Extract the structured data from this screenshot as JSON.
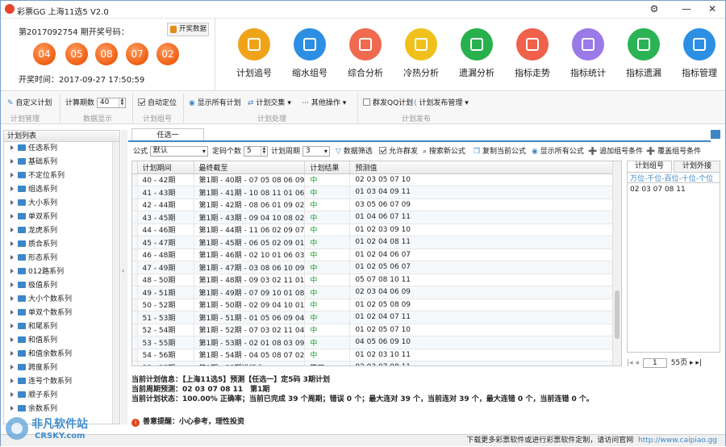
{
  "window": {
    "title": "彩票GG 上海11选5 V2.0",
    "gear": "⚙",
    "minimize": "—",
    "close": "✕"
  },
  "draw": {
    "title": "第2017092754 期开奖号码：",
    "button": "开奖数据",
    "balls": [
      "04",
      "05",
      "08",
      "07",
      "02"
    ],
    "time": "开奖时间：2017-09-27 17:50:59"
  },
  "bigbuttons": [
    {
      "label": "计划追号",
      "color": "#f0a319",
      "icon": "monitor-icon"
    },
    {
      "label": "缩水组号",
      "color": "#2d8fe3",
      "icon": "rocket-icon"
    },
    {
      "label": "综合分析",
      "color": "#f06a4f",
      "icon": "pie-chart-icon"
    },
    {
      "label": "冷热分析",
      "color": "#f0c11c",
      "icon": "sun-icon"
    },
    {
      "label": "遗漏分析",
      "color": "#27b04c",
      "icon": "bar-chart-icon"
    },
    {
      "label": "指标走势",
      "color": "#f0604a",
      "icon": "trend-icon"
    },
    {
      "label": "指标统计",
      "color": "#9a7ae6",
      "icon": "stats-icon"
    },
    {
      "label": "指标遗漏",
      "color": "#2ab354",
      "icon": "share-icon"
    },
    {
      "label": "指标管理",
      "color": "#2d8fe3",
      "icon": "sliders-icon"
    }
  ],
  "toolbar": {
    "custom_plan": "自定义计划",
    "calc_periods_label": "计算期数",
    "calc_periods_value": "40",
    "auto_locate": "自动定位",
    "show_all": "显示所有计划",
    "plan_cross": "计划交集",
    "other_ops": "其他操作",
    "qq_plan": "群发QQ计划",
    "publish": "计划发布管理",
    "group_plan": "计划管理",
    "group_data": "数据显示",
    "group_number": "计划组号",
    "group_process": "计划处理",
    "group_publish": "计划发布"
  },
  "left": {
    "header": "计划列表",
    "items": [
      "任选系列",
      "基础系列",
      "不定位系列",
      "组选系列",
      "大小系列",
      "单双系列",
      "龙虎系列",
      "质合系列",
      "形态系列",
      "012路系列",
      "极值系列",
      "大小个数系列",
      "单双个数系列",
      "和尾系列",
      "和值系列",
      "和值余数系列",
      "跨度系列",
      "连号个数系列",
      "顺子系列",
      "余数系列"
    ]
  },
  "tab": {
    "label": "任选一"
  },
  "formula": {
    "label": "公式",
    "value": "默认",
    "code_count_label": "定码个数",
    "code_count": "5",
    "cycle_label": "计划周期",
    "cycle": "3",
    "filter": "数据筛选",
    "allow_group": "允许群发",
    "search": "搜索新公式",
    "copy": "复制当前公式",
    "show_all": "显示所有公式",
    "add_cond": "追加组号条件",
    "cover_cond": "覆盖组号条件"
  },
  "grid": {
    "columns": [
      "计划期间",
      "最终截至",
      "计划结果",
      "预测值"
    ],
    "rows": [
      [
        "40 - 42期",
        "第1期 - 40期 - 07 05 08 06 09",
        "中",
        "02 03 05 07 10"
      ],
      [
        "41 - 43期",
        "第1期 - 41期 - 10 08 11 01 06",
        "中",
        "01 03 04 09 11"
      ],
      [
        "42 - 44期",
        "第1期 - 42期 - 08 06 01 09 02",
        "中",
        "03 05 06 07 09"
      ],
      [
        "43 - 45期",
        "第1期 - 43期 - 09 04 10 08 02",
        "中",
        "01 04 06 07 11"
      ],
      [
        "44 - 46期",
        "第1期 - 44期 - 11 06 02 09 07",
        "中",
        "01 02 03 09 10"
      ],
      [
        "45 - 47期",
        "第1期 - 45期 - 06 05 02 09 01",
        "中",
        "01 02 04 08 11"
      ],
      [
        "46 - 48期",
        "第1期 - 46期 - 02 10 01 06 03",
        "中",
        "01 02 04 06 07"
      ],
      [
        "47 - 49期",
        "第1期 - 47期 - 03 08 06 10 09",
        "中",
        "01 02 05 06 07"
      ],
      [
        "48 - 50期",
        "第1期 - 48期 - 09 03 02 11 01",
        "中",
        "05 07 08 10 11"
      ],
      [
        "49 - 51期",
        "第1期 - 49期 - 07 09 10 01 08",
        "中",
        "02 03 04 06 09"
      ],
      [
        "50 - 52期",
        "第1期 - 50期 - 02 09 04 10 01",
        "中",
        "01 02 05 08 09"
      ],
      [
        "51 - 53期",
        "第1期 - 51期 - 01 05 06 09 04",
        "中",
        "01 02 04 07 11"
      ],
      [
        "52 - 54期",
        "第1期 - 52期 - 07 03 02 11 04",
        "中",
        "01 02 05 07 10"
      ],
      [
        "53 - 55期",
        "第1期 - 53期 - 02 01 08 03 09",
        "中",
        "04 05 06 09 10"
      ],
      [
        "54 - 56期",
        "第1期 - 54期 - 04 05 08 07 02",
        "中",
        "01 02 03 10 11"
      ],
      [
        "55 - 57期",
        "第1期 - 55期进行中...",
        "等开",
        "02 03 07 08 11"
      ]
    ]
  },
  "right": {
    "tab1": "计划组号",
    "tab2": "计划外接",
    "subtitle": "万位-千位-百位-十位-个位",
    "value": "02 03 07 08 11",
    "page": "1",
    "pages": "55页"
  },
  "info": {
    "line1": "当前计划信息：【上海11选5】预测【任选一】定5码 3期计划",
    "line2": "当前周期预测：02 03 07 08 11　第1期",
    "line3": "当前计划状态：100.00% 正确率；当前已完成 39 个周期；错误 0 个；最大连对 39 个，当前连对 39 个，最大连错 0 个，当前连错 0 个。"
  },
  "warn": "善意提醒：小心参考，理性投资",
  "status": {
    "text": "下载更多彩票软件或进行彩票软件定制，请访问官网",
    "url": "http://www.caipiao.gg"
  },
  "watermark": {
    "cn": "非凡软件站",
    "en": "CRSKY.com"
  }
}
